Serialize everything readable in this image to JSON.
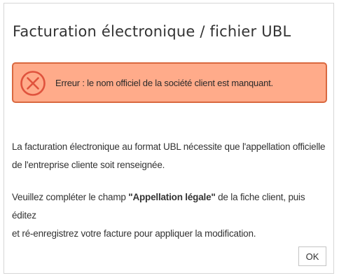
{
  "dialog": {
    "title": "Facturation électronique / fichier UBL",
    "alert": {
      "icon": "error-circle-x-icon",
      "message": "Erreur : le nom officiel de la société client est manquant.",
      "colors": {
        "background": "#ffab8a",
        "border": "#d9683f",
        "icon": "#e0533d"
      }
    },
    "paragraph1": {
      "line1": "La facturation électronique au format UBL nécessite que l'appellation officielle",
      "line2": "de l'entreprise cliente soit renseignée."
    },
    "paragraph2": {
      "before": "Veuillez compléter le champ ",
      "field": "\"Appellation légale\"",
      "after": " de la fiche client, puis éditez",
      "line2": "et ré-enregistrez votre facture pour appliquer la modification."
    },
    "ok_label": "OK"
  }
}
